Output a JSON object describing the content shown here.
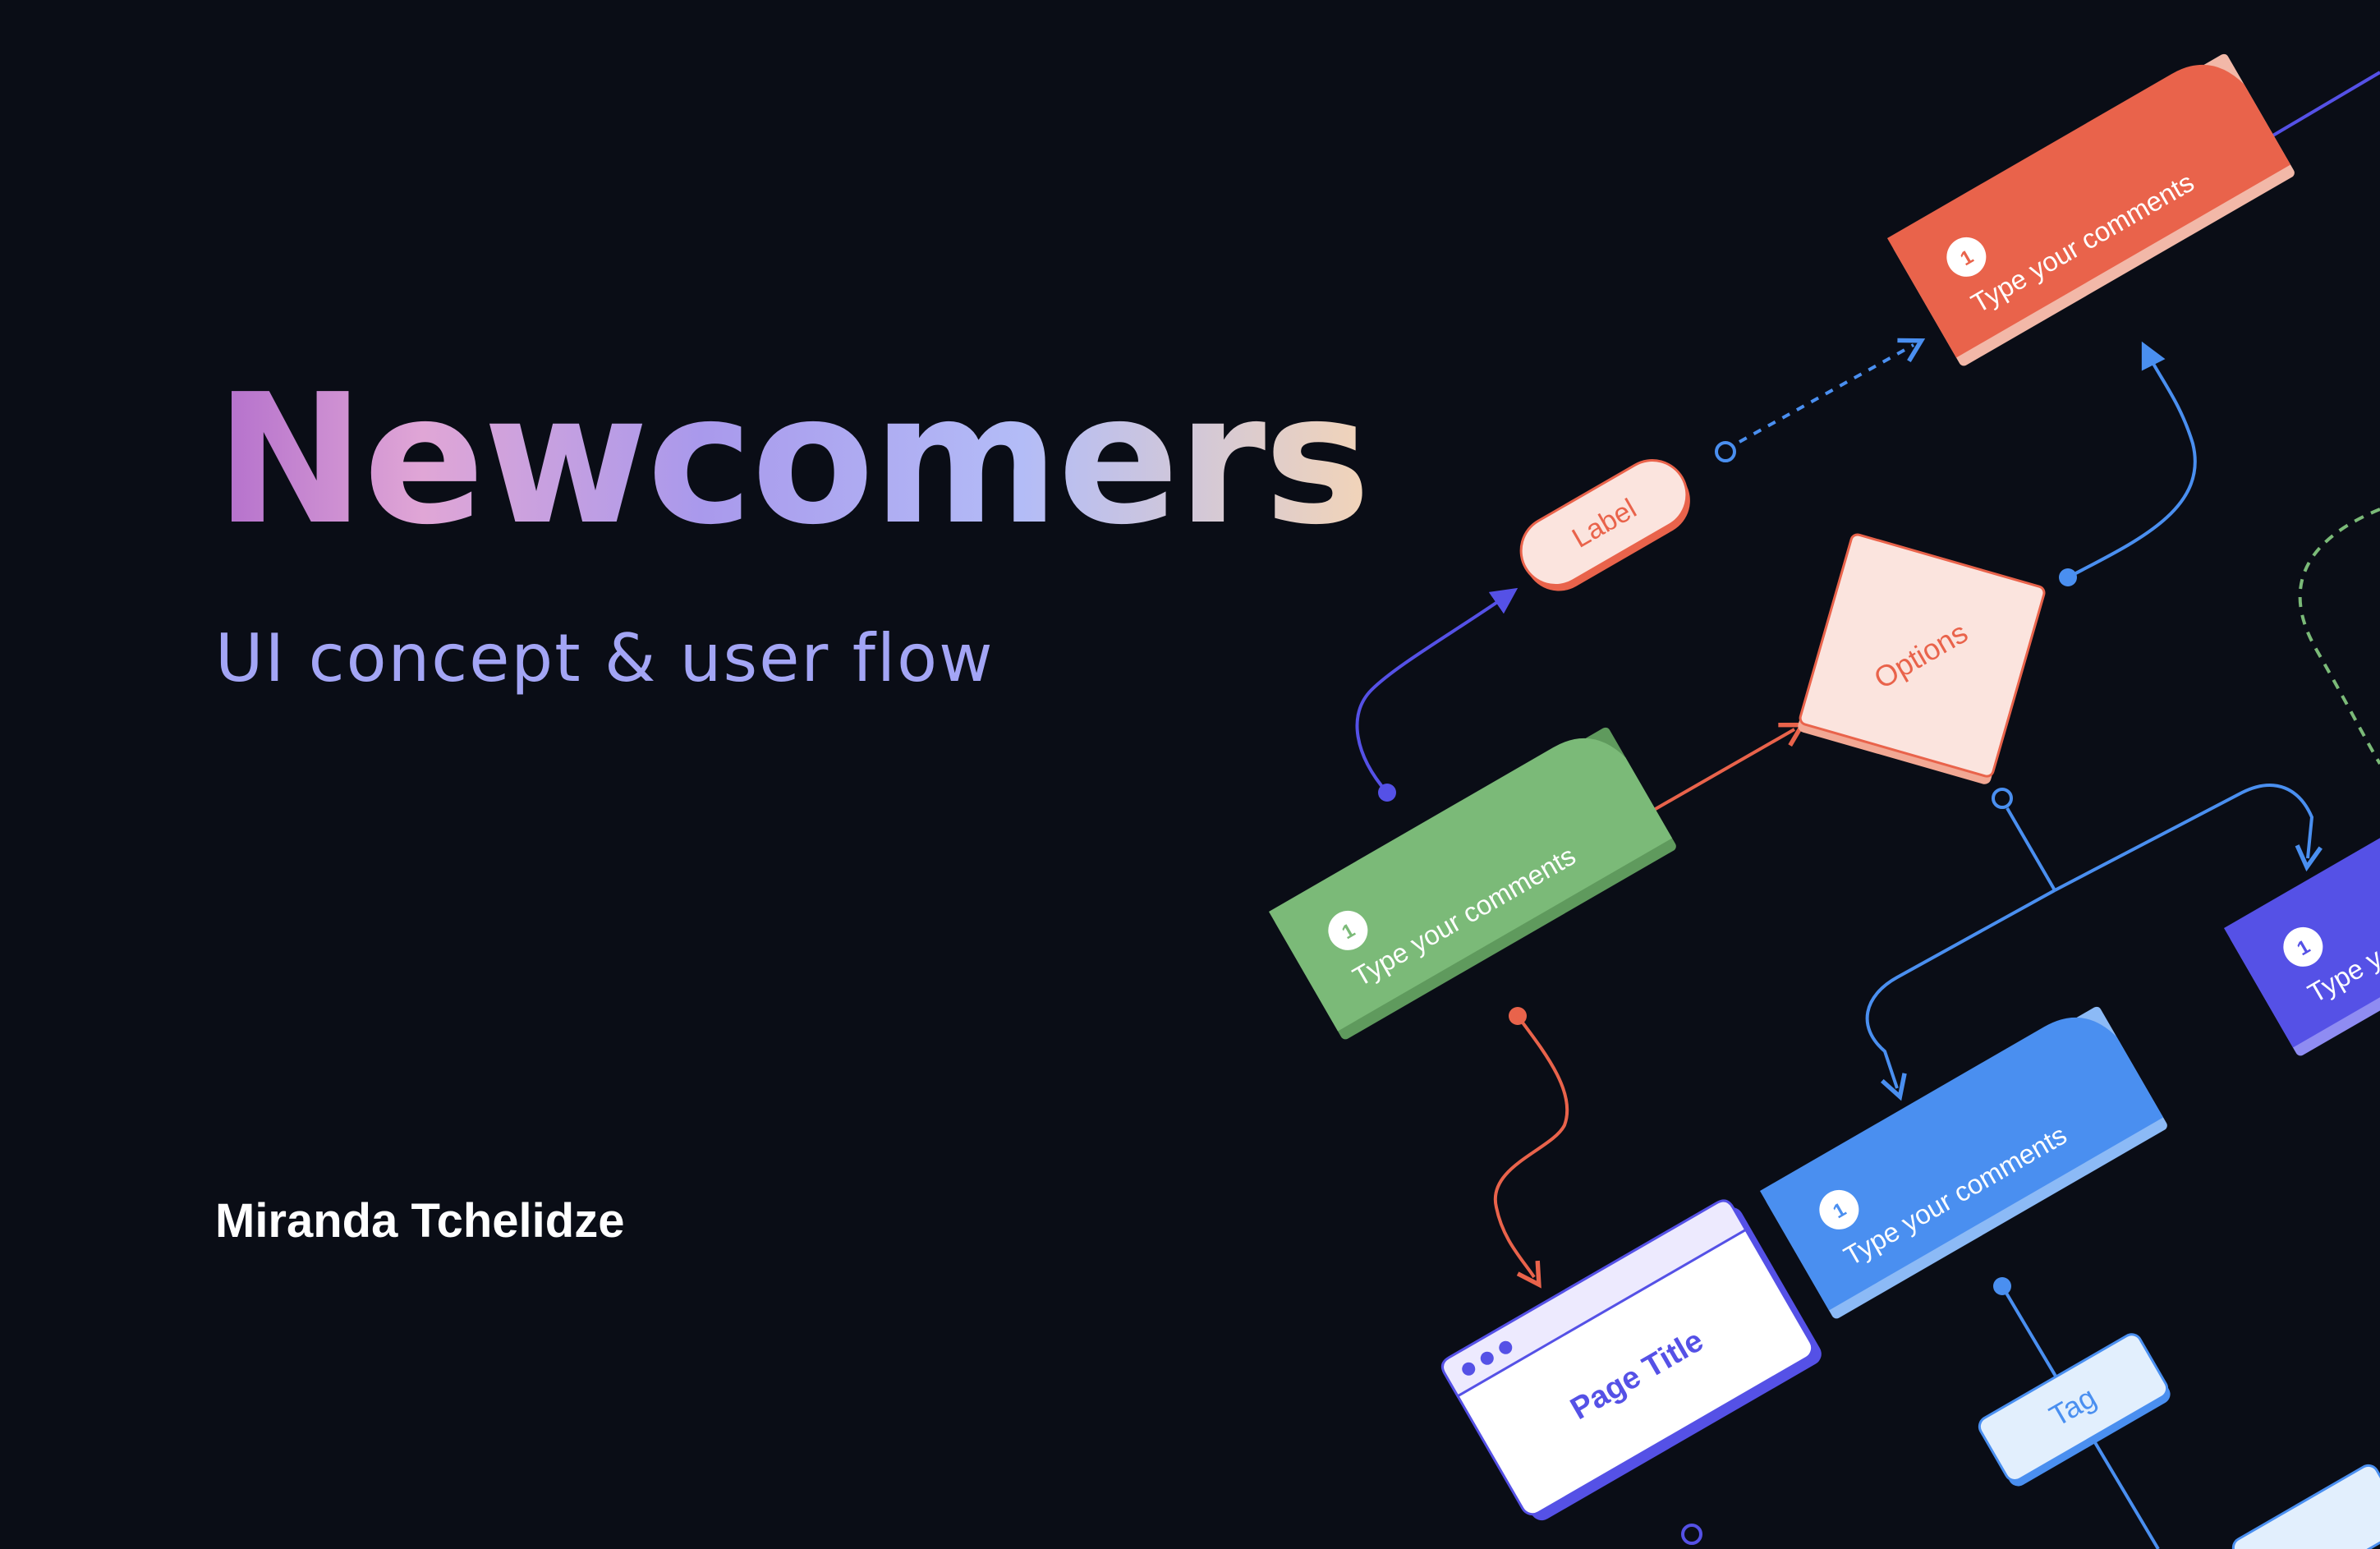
{
  "title": "Newcomers",
  "subtitle": "UI concept & user flow",
  "author": "Miranda Tchelidze",
  "diagram": {
    "label_pill": "Label",
    "options_box": "Options",
    "tag_box": "Tag",
    "window_title": "Page Title",
    "cards": [
      {
        "number": "1",
        "text": "Type your comments",
        "color": "#e9634b"
      },
      {
        "number": "1",
        "text": "Type your comments",
        "color": "#7bba78"
      },
      {
        "number": "1",
        "text": "Type your comments",
        "color": "#4a8ff0"
      },
      {
        "number": "1",
        "text": "Type yo",
        "color": "#5551e6"
      }
    ]
  },
  "colors": {
    "background": "#0a0d16",
    "red": "#e9634b",
    "green": "#7bba78",
    "blue": "#4a8ff0",
    "indigo": "#5551e6",
    "peach": "#fbe4de"
  }
}
